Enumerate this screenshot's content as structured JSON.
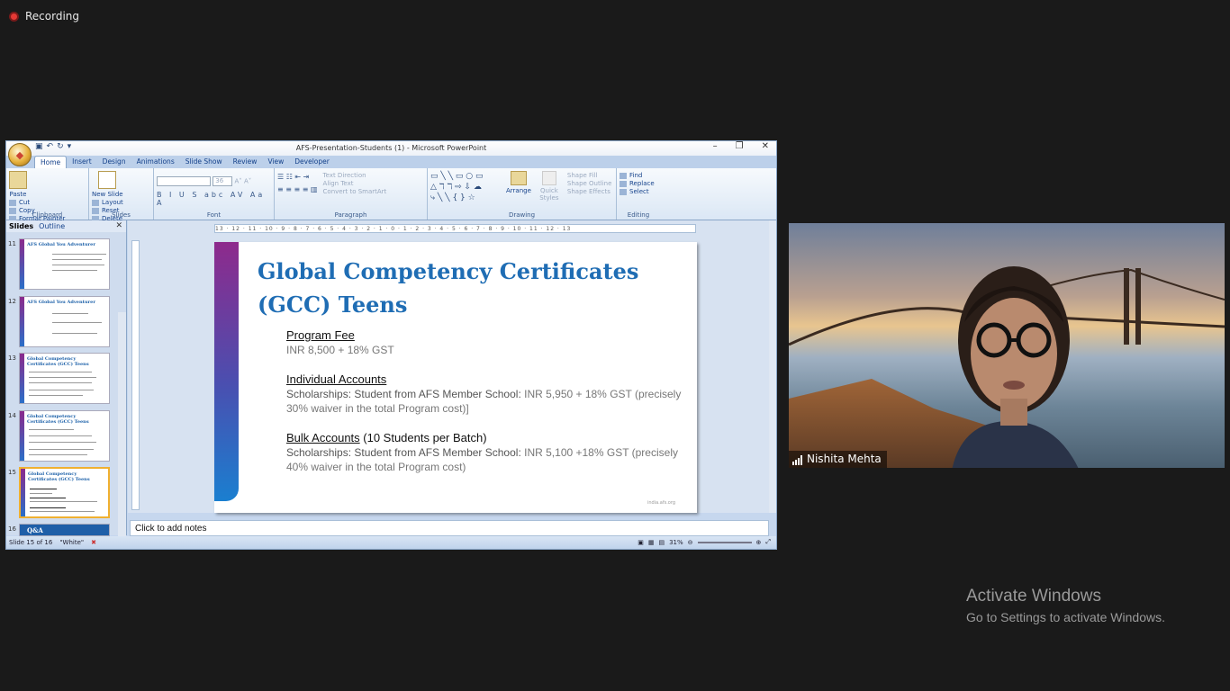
{
  "meeting": {
    "recording_label": "Recording"
  },
  "powerpoint": {
    "window_title": "AFS-Presentation-Students (1) - Microsoft PowerPoint",
    "tabs": [
      "Home",
      "Insert",
      "Design",
      "Animations",
      "Slide Show",
      "Review",
      "View",
      "Developer"
    ],
    "ribbon": {
      "clipboard": {
        "paste": "Paste",
        "cut": "Cut",
        "copy": "Copy",
        "format_painter": "Format Painter",
        "group": "Clipboard"
      },
      "slides": {
        "new_slide": "New Slide",
        "layout": "Layout",
        "reset": "Reset",
        "delete": "Delete",
        "group": "Slides"
      },
      "font": {
        "size": "36",
        "group": "Font"
      },
      "paragraph": {
        "text_direction": "Text Direction",
        "align_text": "Align Text",
        "convert": "Convert to SmartArt",
        "group": "Paragraph"
      },
      "drawing": {
        "arrange": "Arrange",
        "quick_styles": "Quick Styles",
        "shape_fill": "Shape Fill",
        "shape_outline": "Shape Outline",
        "shape_effects": "Shape Effects",
        "group": "Drawing"
      },
      "editing": {
        "find": "Find",
        "replace": "Replace",
        "select": "Select",
        "group": "Editing"
      }
    },
    "panel_tabs": {
      "slides": "Slides",
      "outline": "Outline"
    },
    "thumbnails": [
      {
        "num": "11",
        "title": "AFS Global You Adventurer"
      },
      {
        "num": "12",
        "title": "AFS Global You Adventurer"
      },
      {
        "num": "13",
        "title": "Global Competency Certificates (GCC) Teens"
      },
      {
        "num": "14",
        "title": "Global Competency Certificates (GCC) Teens"
      },
      {
        "num": "15",
        "title": "Global Competency Certificates (GCC) Teens"
      },
      {
        "num": "16",
        "title": "Q&A"
      }
    ],
    "ruler_text": "13 · 12 · 11 · 10 · 9 · 8 · 7 · 6 · 5 · 4 · 3 · 2 · 1 · 0 · 1 · 2 · 3 · 4 · 5 · 6 · 7 · 8 · 9 · 10 · 11 · 12 · 13",
    "slide": {
      "title": "Global Competency Certificates (GCC) Teens",
      "sections": [
        {
          "heading": "Program Fee",
          "heading_note": "",
          "label": "",
          "detail": "INR 8,500 + 18% GST"
        },
        {
          "heading": "Individual Accounts",
          "heading_note": "",
          "label": "Scholarships: Student from AFS Member School:",
          "detail": " INR 5,950 + 18% GST (precisely 30% waiver in the total Program cost)]"
        },
        {
          "heading": "Bulk Accounts",
          "heading_note": " (10 Students per Batch)",
          "label": "Scholarships: Student from AFS Member School:",
          "detail": " INR 5,100 +18% GST (precisely 40% waiver in the total Program cost)"
        }
      ],
      "footer": "india.afs.org"
    },
    "notes_placeholder": "Click to add notes",
    "status": {
      "slide_of": "Slide 15 of 16",
      "theme": "\"White\"",
      "zoom": "31%"
    }
  },
  "video": {
    "participant_name": "Nishita Mehta"
  },
  "watermark": {
    "line1": "Activate Windows",
    "line2": "Go to Settings to activate Windows."
  }
}
